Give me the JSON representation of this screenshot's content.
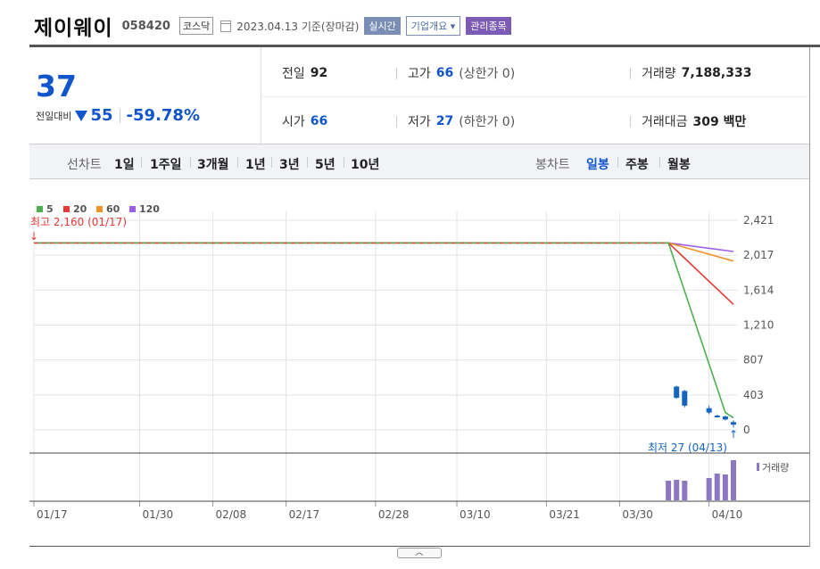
{
  "header": {
    "company_name": "제이웨이",
    "code": "058420",
    "market": "코스닥",
    "date": "2023.04.13 기준(장마감)",
    "btn_realtime": "실시간",
    "btn_company": "기업개요",
    "btn_managed": "관리종목"
  },
  "price": {
    "current": "37",
    "change_label": "전일대비",
    "change_value": "55",
    "change_percent": "-59.78%"
  },
  "summary": {
    "prev_close_label": "전일",
    "prev_close": "92",
    "high_label": "고가",
    "high": "66",
    "upper_limit": "(상한가 0)",
    "volume_label": "거래량",
    "volume": "7,188,333",
    "open_label": "시가",
    "open": "66",
    "low_label": "저가",
    "low": "27",
    "lower_limit": "(하한가 0)",
    "amount_label": "거래대금",
    "amount": "309 백만"
  },
  "periods": {
    "line_label": "선차트",
    "line_items": [
      "1일",
      "1주일",
      "3개월",
      "1년",
      "3년",
      "5년",
      "10년"
    ],
    "candle_label": "봉차트",
    "candle_items": [
      "일봉",
      "주봉",
      "월봉"
    ],
    "candle_active": "일봉"
  },
  "chart_data": {
    "type": "line",
    "legend": [
      {
        "name": "5",
        "color": "#4caf50"
      },
      {
        "name": "20",
        "color": "#e53935"
      },
      {
        "name": "60",
        "color": "#f0932b"
      },
      {
        "name": "120",
        "color": "#9b5de5"
      }
    ],
    "x_ticks": [
      "01/17",
      "01/30",
      "02/08",
      "02/17",
      "02/28",
      "03/10",
      "03/21",
      "03/30",
      "04/10"
    ],
    "y_ticks": [
      "2,421",
      "2,017",
      "1,614",
      "1,210",
      "807",
      "403",
      "0"
    ],
    "ylim": [
      0,
      2421
    ],
    "high_annotation": "최고 2,160 (01/17)",
    "low_annotation": "최저 27 (04/13)",
    "volume_label": "거래량",
    "moving_averages": [
      {
        "name": "5",
        "points": [
          [
            "01/17",
            2160
          ],
          [
            "04/05",
            2160
          ],
          [
            "04/12",
            200
          ],
          [
            "04/13",
            140
          ]
        ]
      },
      {
        "name": "20",
        "points": [
          [
            "01/17",
            2160
          ],
          [
            "04/05",
            2160
          ],
          [
            "04/13",
            1450
          ]
        ]
      },
      {
        "name": "60",
        "points": [
          [
            "01/17",
            2160
          ],
          [
            "04/05",
            2160
          ],
          [
            "04/13",
            1950
          ]
        ]
      },
      {
        "name": "120",
        "points": [
          [
            "01/17",
            2160
          ],
          [
            "04/05",
            2160
          ],
          [
            "04/13",
            2060
          ]
        ]
      }
    ],
    "candles": [
      {
        "date": "04/06",
        "open": 500,
        "close": 370,
        "high": 510,
        "low": 360
      },
      {
        "date": "04/07",
        "open": 450,
        "close": 280,
        "high": 460,
        "low": 260
      },
      {
        "date": "04/10",
        "open": 250,
        "close": 200,
        "high": 280,
        "low": 180
      },
      {
        "date": "04/11",
        "open": 165,
        "close": 160,
        "high": 175,
        "low": 150
      },
      {
        "date": "04/12",
        "open": 155,
        "close": 120,
        "high": 165,
        "low": 110
      },
      {
        "date": "04/13",
        "open": 90,
        "close": 60,
        "high": 110,
        "low": 27
      }
    ],
    "volumes": [
      {
        "date": "04/05",
        "value": 0.44
      },
      {
        "date": "04/06",
        "value": 0.46
      },
      {
        "date": "04/07",
        "value": 0.44
      },
      {
        "date": "04/10",
        "value": 0.5
      },
      {
        "date": "04/11",
        "value": 0.6
      },
      {
        "date": "04/12",
        "value": 0.58
      },
      {
        "date": "04/13",
        "value": 0.9
      }
    ],
    "grid": true,
    "legend_position": "top-left"
  }
}
